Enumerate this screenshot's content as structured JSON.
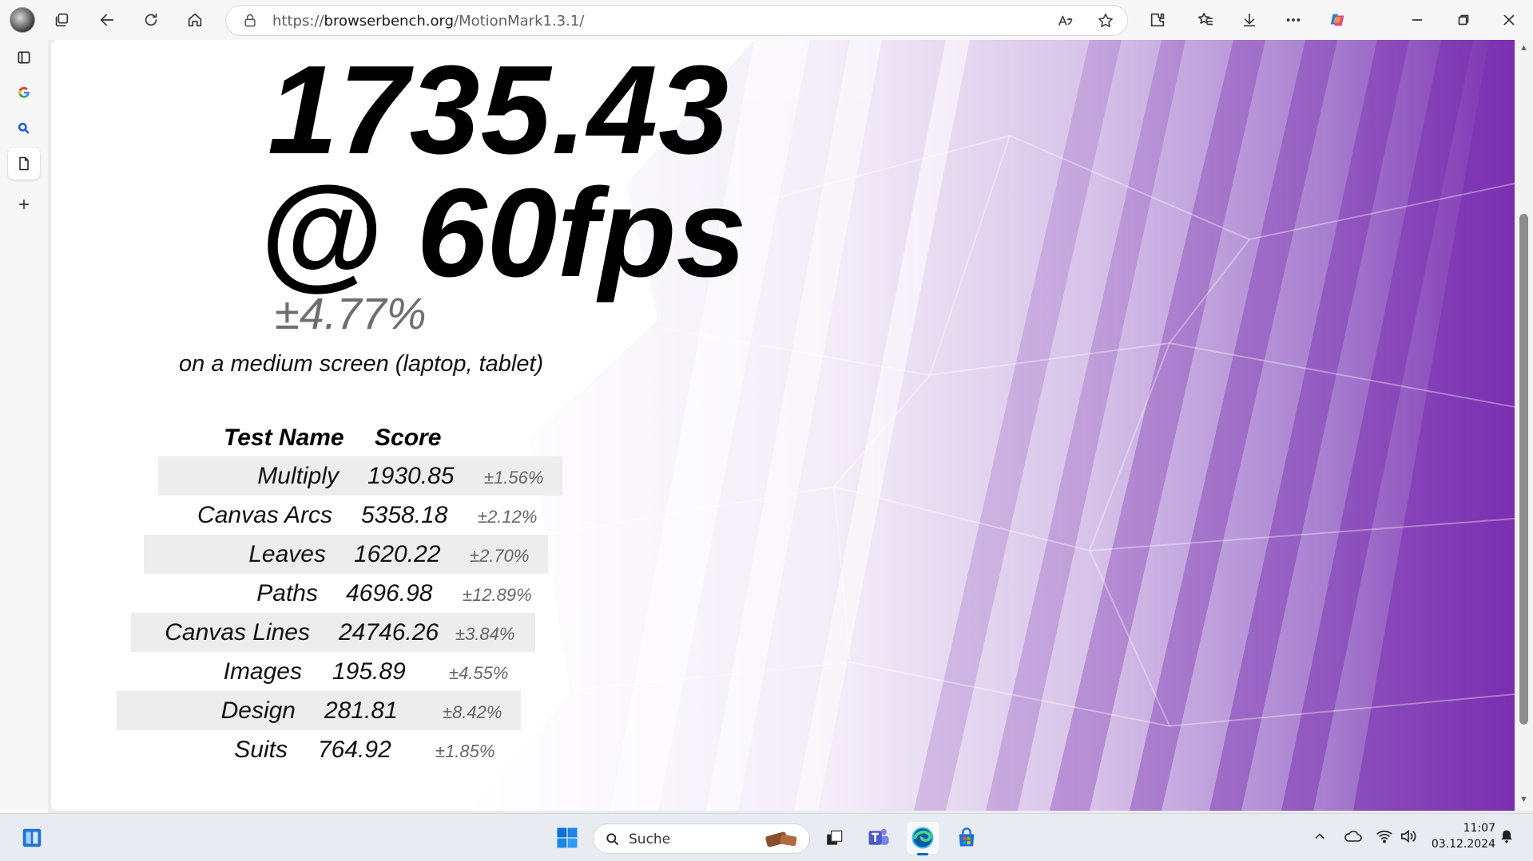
{
  "browser": {
    "url_prefix": "https://",
    "url_host": "browserbench.org",
    "url_path": "/MotionMark1.3.1/"
  },
  "result": {
    "score": "1735.43",
    "fps": "@ 60fps",
    "margin": "±4.77%",
    "screen_note": "on a medium screen (laptop, tablet)"
  },
  "table": {
    "headers": {
      "name": "Test Name",
      "score": "Score"
    },
    "rows": [
      {
        "name": "Multiply",
        "score": "1930.85",
        "error": "±1.56%"
      },
      {
        "name": "Canvas Arcs",
        "score": "5358.18",
        "error": "±2.12%"
      },
      {
        "name": "Leaves",
        "score": "1620.22",
        "error": "±2.70%"
      },
      {
        "name": "Paths",
        "score": "4696.98",
        "error": "±12.89%"
      },
      {
        "name": "Canvas Lines",
        "score": "24746.26",
        "error": "±3.84%"
      },
      {
        "name": "Images",
        "score": "195.89",
        "error": "±4.55%"
      },
      {
        "name": "Design",
        "score": "281.81",
        "error": "±8.42%"
      },
      {
        "name": "Suits",
        "score": "764.92",
        "error": "±1.85%"
      }
    ]
  },
  "taskbar": {
    "search_placeholder": "Suche",
    "time": "11:07",
    "date": "03.12.2024"
  },
  "colors": {
    "accent_purple": "#7a2fb0",
    "taskbar_bg": "#e8ecf2",
    "edge_blue": "#0067c0"
  }
}
